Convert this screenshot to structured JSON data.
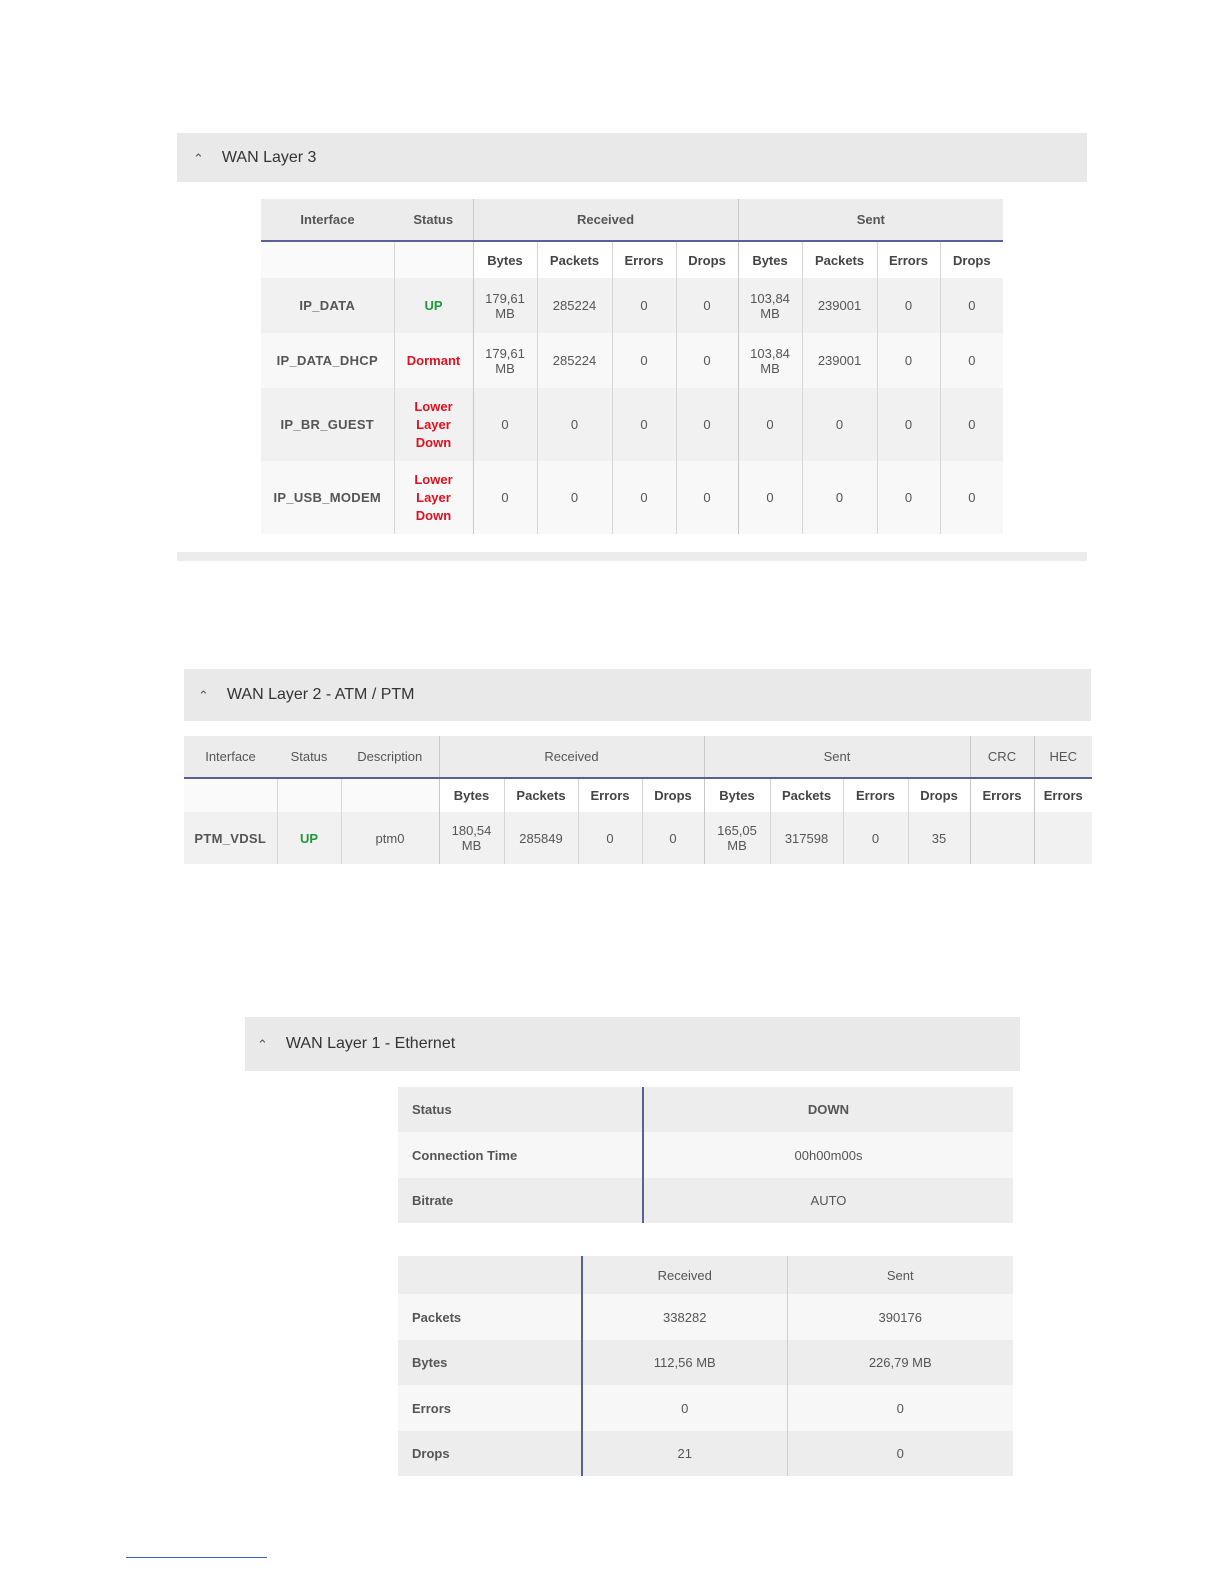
{
  "layer3": {
    "title": "WAN Layer 3",
    "headers": {
      "interface": "Interface",
      "status": "Status",
      "received": "Received",
      "sent": "Sent"
    },
    "sub": [
      "Bytes",
      "Packets",
      "Errors",
      "Drops",
      "Bytes",
      "Packets",
      "Errors",
      "Drops"
    ],
    "rows": [
      {
        "interface": "IP_DATA",
        "status": "UP",
        "rx_bytes": "179,61 MB",
        "rx_packets": "285224",
        "rx_errors": "0",
        "rx_drops": "0",
        "tx_bytes": "103,84 MB",
        "tx_packets": "239001",
        "tx_errors": "0",
        "tx_drops": "0"
      },
      {
        "interface": "IP_DATA_DHCP",
        "status": "Dormant",
        "rx_bytes": "179,61 MB",
        "rx_packets": "285224",
        "rx_errors": "0",
        "rx_drops": "0",
        "tx_bytes": "103,84 MB",
        "tx_packets": "239001",
        "tx_errors": "0",
        "tx_drops": "0"
      },
      {
        "interface": "IP_BR_GUEST",
        "status": "Lower Layer Down",
        "rx_bytes": "0",
        "rx_packets": "0",
        "rx_errors": "0",
        "rx_drops": "0",
        "tx_bytes": "0",
        "tx_packets": "0",
        "tx_errors": "0",
        "tx_drops": "0"
      },
      {
        "interface": "IP_USB_MODEM",
        "status": "Lower Layer Down",
        "rx_bytes": "0",
        "rx_packets": "0",
        "rx_errors": "0",
        "rx_drops": "0",
        "tx_bytes": "0",
        "tx_packets": "0",
        "tx_errors": "0",
        "tx_drops": "0"
      }
    ]
  },
  "layer2": {
    "title": "WAN Layer 2 - ATM / PTM",
    "headers": {
      "interface": "Interface",
      "status": "Status",
      "description": "Description",
      "received": "Received",
      "sent": "Sent",
      "crc": "CRC",
      "hec": "HEC"
    },
    "sub": [
      "Bytes",
      "Packets",
      "Errors",
      "Drops",
      "Bytes",
      "Packets",
      "Errors",
      "Drops",
      "Errors",
      "Errors"
    ],
    "row": {
      "interface": "PTM_VDSL",
      "status": "UP",
      "description": "ptm0",
      "rx_bytes": "180,54 MB",
      "rx_packets": "285849",
      "rx_errors": "0",
      "rx_drops": "0",
      "tx_bytes": "165,05 MB",
      "tx_packets": "317598",
      "tx_errors": "0",
      "tx_drops": "35",
      "crc_errors": "",
      "hec_errors": ""
    }
  },
  "layer1": {
    "title": "WAN Layer 1 - Ethernet",
    "info": {
      "status_label": "Status",
      "status_value": "DOWN",
      "conn_label": "Connection Time",
      "conn_value": "00h00m00s",
      "bitrate_label": "Bitrate",
      "bitrate_value": "AUTO"
    },
    "stats": {
      "received": "Received",
      "sent": "Sent",
      "rows": [
        {
          "label": "Packets",
          "received": "338282",
          "sent": "390176"
        },
        {
          "label": "Bytes",
          "received": "112,56 MB",
          "sent": "226,79 MB"
        },
        {
          "label": "Errors",
          "received": "0",
          "sent": "0"
        },
        {
          "label": "Drops",
          "received": "21",
          "sent": "0"
        }
      ]
    }
  },
  "colors": {
    "up": "#1f9a3a",
    "down": "#e01020",
    "header_bg": "#e9e9e9",
    "accent_line": "#5a5f9a"
  }
}
